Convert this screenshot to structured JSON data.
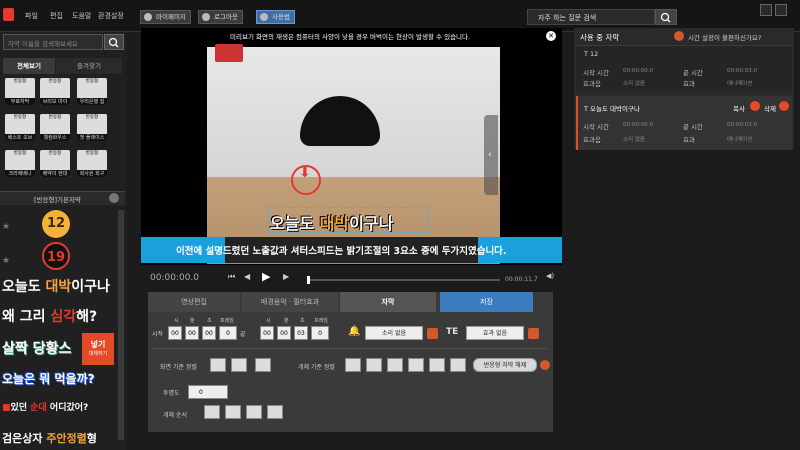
{
  "topbar": {
    "menu": [
      "파일",
      "편집",
      "도움말",
      "환경설정"
    ],
    "buttons": [
      "마이페이지",
      "로그아웃",
      "사용법"
    ],
    "faq": "자주 하는 질문 검색"
  },
  "left": {
    "search_placeholder": "자막 이름을 검색해보세요",
    "tabs": [
      "전체보기",
      "즐겨찾기"
    ],
    "thumbs": [
      {
        "label": "무료자막",
        "badge": "반응형"
      },
      {
        "label": "브리보 마이",
        "badge": "반응형"
      },
      {
        "label": "우리은행 쉽",
        "badge": "반응형"
      },
      {
        "label": "베스트 오브",
        "badge": "반응형"
      },
      {
        "label": "웰컴화우스",
        "badge": "반응형"
      },
      {
        "label": "첫 플레이스",
        "badge": "반응형"
      },
      {
        "label": "크라에배니",
        "badge": "반응형"
      },
      {
        "label": "배약이 현대",
        "badge": "반응형"
      },
      {
        "label": "회사원 회구",
        "badge": "반응형"
      }
    ],
    "preset_header": "[반응형]기본자막",
    "presets": {
      "num1": "12",
      "num2": "19",
      "t1a": "오늘도 ",
      "t1b": "대박",
      "t1c": "이구나",
      "t2a": "왜 그리 ",
      "t2b": "심각",
      "t2c": "해?",
      "t3": "살짝 당황스",
      "t4": "오늘은 뭐 먹을까?",
      "t5a": "있던 ",
      "t5b": "순대",
      "t5c": " 어디갔어?",
      "t6a": "검은상자 ",
      "t6b": "주안정렬",
      "t6c": "형"
    },
    "insert_label": "넣기",
    "insert_sub": "대체하기"
  },
  "video": {
    "warning": "미리보기 화면의 재생은 컴퓨터의 사양이 낮을 경우 버벅이는 현상이 발생할 수 있습니다.",
    "subtitle_a": "오늘도 ",
    "subtitle_b": "대박",
    "subtitle_c": "이구나",
    "subtitle2": "이전에 설명드렸던 노출값과 셔터스피드는 밝기조절의 3요소 중에 두가지였습니다.",
    "time_current": "00:00:00.0",
    "time_total": "00:00:11.7"
  },
  "edit": {
    "tabs": [
      "영상편집",
      "배경음악 · 필터효과",
      "자막",
      "저장"
    ],
    "start_label": "시작",
    "end_label": "끝",
    "time_units": [
      "시",
      "분",
      "초",
      "프레임"
    ],
    "start_vals": [
      "00",
      "00",
      "00",
      "0"
    ],
    "end_vals": [
      "00",
      "00",
      "03",
      "0"
    ],
    "sound_none": "소리 없음",
    "effect_none": "효과 없음",
    "align_label": "화면 기준 정렬",
    "obj_align_label": "개체 기준 정렬",
    "responsive_release": "반응형 자막 해제",
    "opacity_label": "투명도",
    "opacity_val": "0",
    "order_label": "개체 순서"
  },
  "right": {
    "header": "사용 중 자막",
    "help": "시간 설정이 불편하신가요?",
    "items": [
      {
        "name": "12",
        "start_label": "시작 시간",
        "start": "00:00:00.0",
        "end_label": "끝 시간",
        "end": "00:00:03.0",
        "fx_label": "효과음",
        "fx": "소리 없음",
        "anim_label": "효과",
        "anim": "애니메이션"
      },
      {
        "name": "오늘도 대박이구나",
        "start_label": "시작 시간",
        "start": "00:00:00.0",
        "end_label": "끝 시간",
        "end": "00:00:03.0",
        "fx_label": "효과음",
        "fx": "소리 없음",
        "anim_label": "효과",
        "anim": "애니메이션"
      }
    ],
    "copy": "복사",
    "delete": "삭제"
  }
}
